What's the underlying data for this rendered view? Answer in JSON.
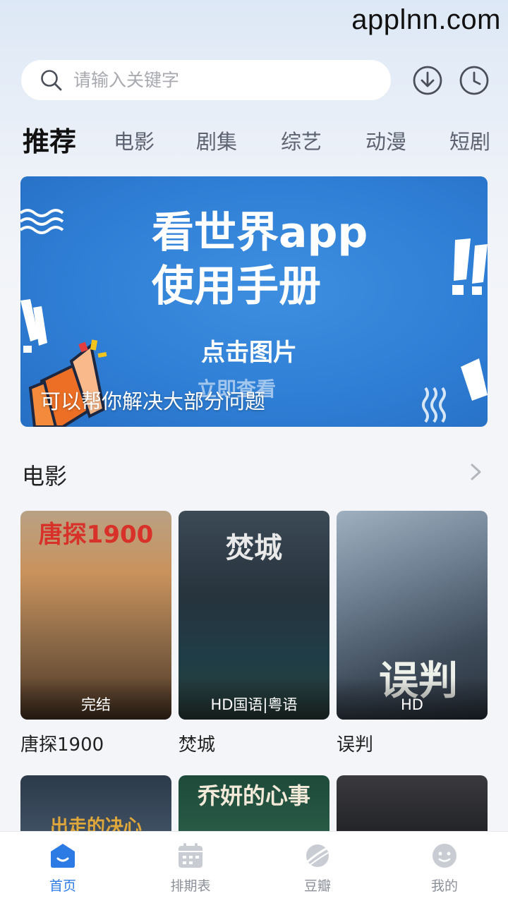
{
  "watermark": "applnn.com",
  "search": {
    "placeholder": "请输入关键字"
  },
  "header_icons": [
    "download-icon",
    "history-icon"
  ],
  "tabs": [
    {
      "label": "推荐",
      "active": true
    },
    {
      "label": "电影"
    },
    {
      "label": "剧集"
    },
    {
      "label": "综艺"
    },
    {
      "label": "动漫"
    },
    {
      "label": "短剧"
    }
  ],
  "banner": {
    "headline_line1": "看世界app",
    "headline_line2": "使用手册",
    "sub_line1": "点击图片",
    "sub_line2": "立即查看",
    "caption": "可以帮你解决大部分问题"
  },
  "section": {
    "title": "电影"
  },
  "movies": [
    {
      "name": "唐探1900",
      "badge": "完结",
      "poster_title": "唐探1900"
    },
    {
      "name": "焚城",
      "badge": "HD国语|粤语",
      "poster_title": "焚城"
    },
    {
      "name": "误判",
      "badge": "HD",
      "poster_title": "误判"
    }
  ],
  "movies_row2": [
    {
      "poster_title": "出走的决心"
    },
    {
      "poster_title": "乔妍的心事"
    },
    {
      "poster_title": ""
    }
  ],
  "bottom_nav": [
    {
      "label": "首页",
      "icon": "home-icon",
      "active": true
    },
    {
      "label": "排期表",
      "icon": "calendar-icon"
    },
    {
      "label": "豆瓣",
      "icon": "planet-icon"
    },
    {
      "label": "我的",
      "icon": "profile-icon"
    }
  ],
  "colors": {
    "accent": "#2c7be5",
    "banner_blue": "#2f7fd6",
    "tab_active": "#111111",
    "tab_inactive": "#5c6270"
  }
}
